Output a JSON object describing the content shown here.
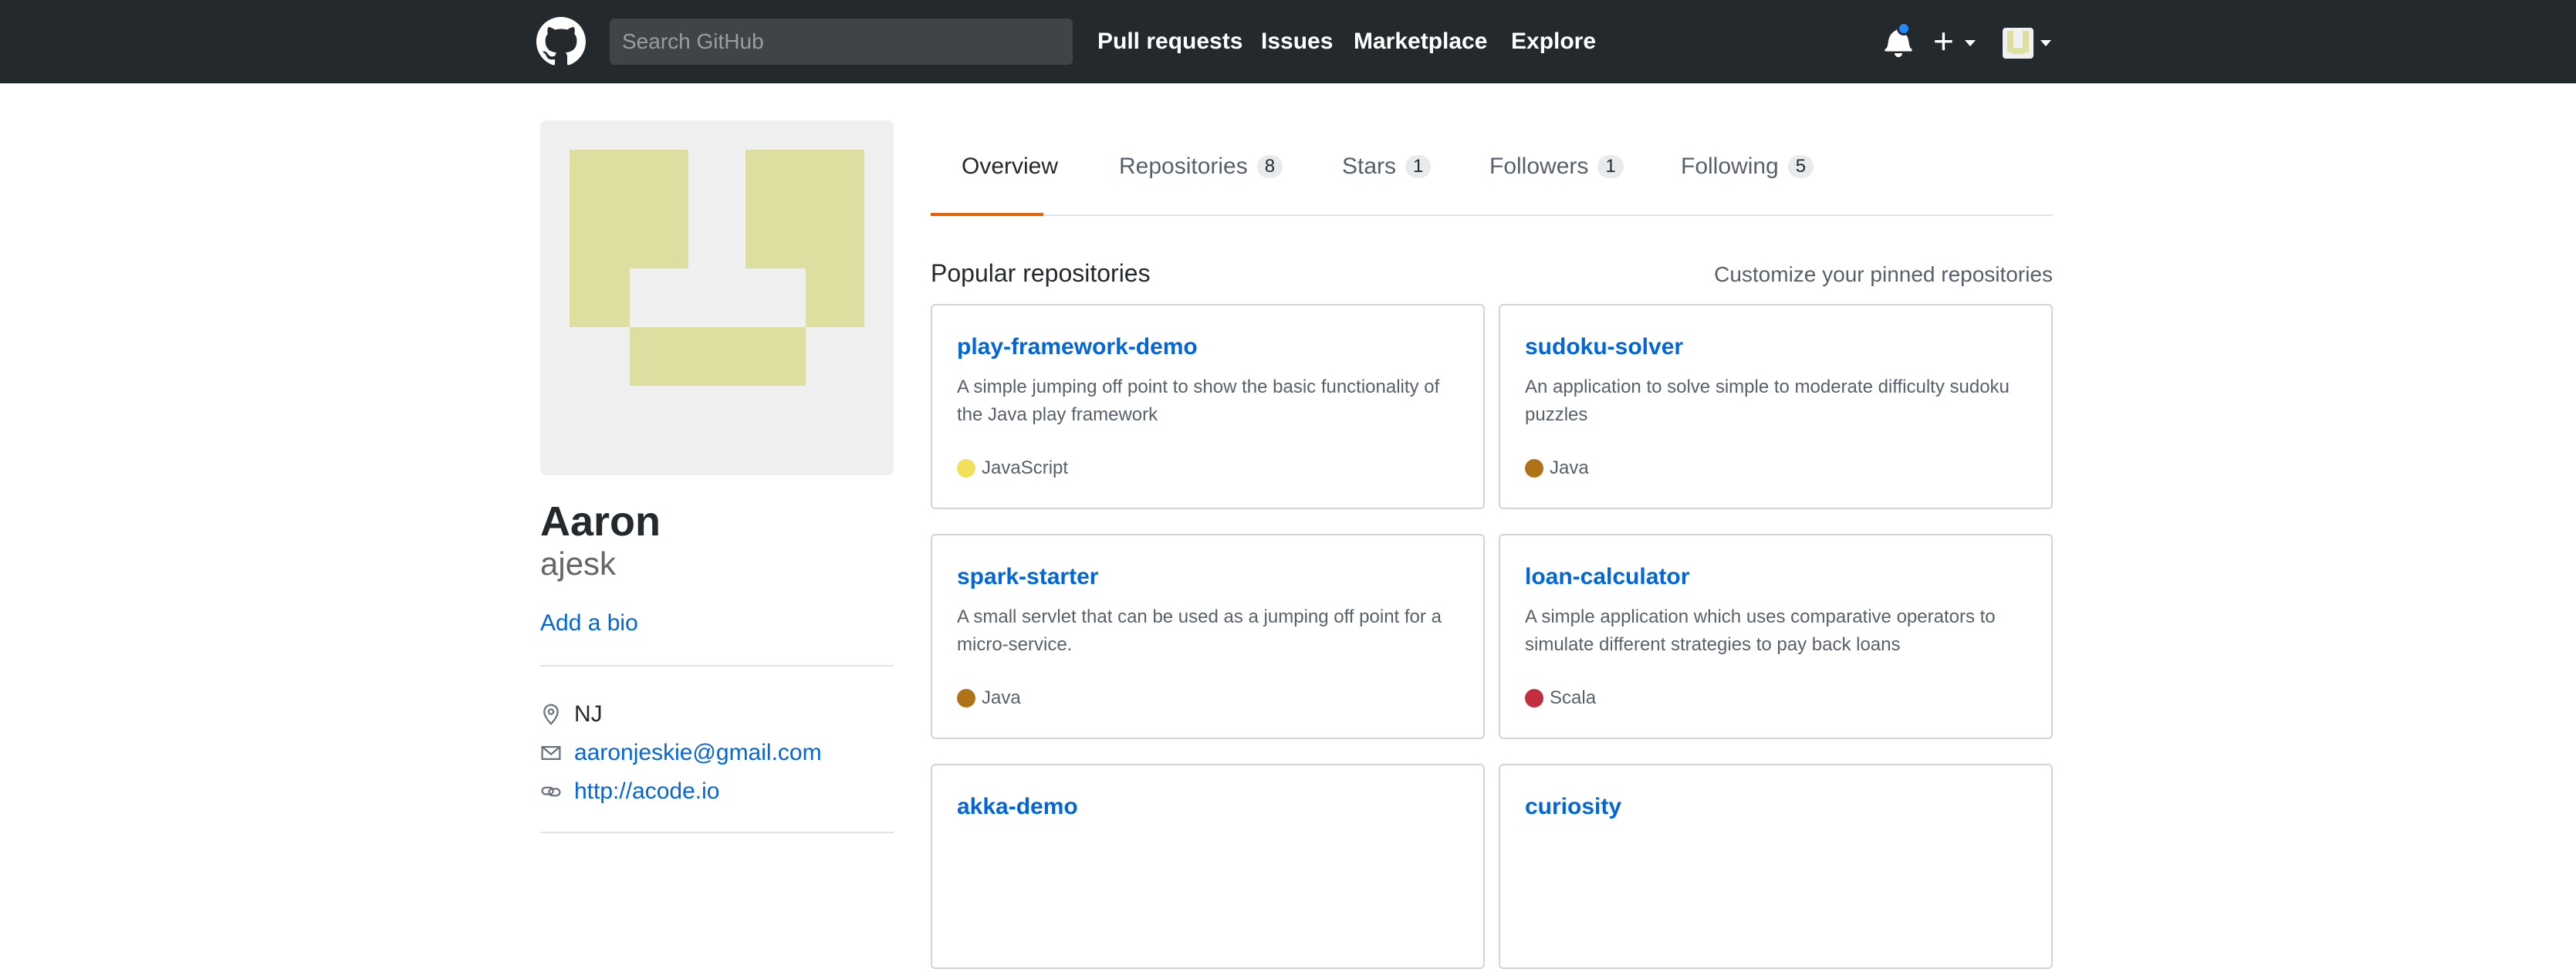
{
  "header": {
    "search_placeholder": "Search GitHub",
    "nav": [
      "Pull requests",
      "Issues",
      "Marketplace",
      "Explore"
    ],
    "notification_unread": true
  },
  "profile": {
    "name": "Aaron",
    "login": "ajesk",
    "add_bio": "Add a bio",
    "location": "NJ",
    "email": "aaronjeskie@gmail.com",
    "website": "http://acode.io",
    "avatar_color": "#dcdf9f"
  },
  "tabs": [
    {
      "label": "Overview",
      "count": null
    },
    {
      "label": "Repositories",
      "count": "8"
    },
    {
      "label": "Stars",
      "count": "1"
    },
    {
      "label": "Followers",
      "count": "1"
    },
    {
      "label": "Following",
      "count": "5"
    }
  ],
  "popular": {
    "title": "Popular repositories",
    "customize": "Customize your pinned repositories",
    "repos": [
      {
        "name": "play-framework-demo",
        "desc": "A simple jumping off point to show the basic functionality of the Java play framework",
        "lang": "JavaScript",
        "lang_color": "#f1e05a"
      },
      {
        "name": "sudoku-solver",
        "desc": "An application to solve simple to moderate difficulty sudoku puzzles",
        "lang": "Java",
        "lang_color": "#b07219"
      },
      {
        "name": "spark-starter",
        "desc": "A small servlet that can be used as a jumping off point for a micro-service.",
        "lang": "Java",
        "lang_color": "#b07219"
      },
      {
        "name": "loan-calculator",
        "desc": "A simple application which uses comparative operators to simulate different strategies to pay back loans",
        "lang": "Scala",
        "lang_color": "#c22d40"
      },
      {
        "name": "akka-demo",
        "desc": "",
        "lang": "",
        "lang_color": ""
      },
      {
        "name": "curiosity",
        "desc": "",
        "lang": "",
        "lang_color": ""
      }
    ]
  }
}
